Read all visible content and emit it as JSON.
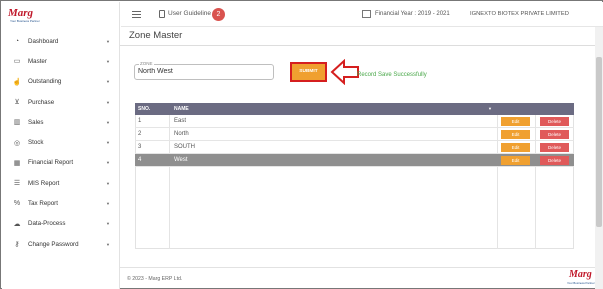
{
  "brand": {
    "logo_text": "Marg",
    "tagline": "Your Business Partner"
  },
  "sidebar": {
    "items": [
      {
        "label": "Dashboard",
        "icon": "dashboard-icon"
      },
      {
        "label": "Master",
        "icon": "folder-icon"
      },
      {
        "label": "Outstanding",
        "icon": "thumbs-up-icon"
      },
      {
        "label": "Purchase",
        "icon": "cart-icon"
      },
      {
        "label": "Sales",
        "icon": "chart-icon"
      },
      {
        "label": "Stock",
        "icon": "database-icon"
      },
      {
        "label": "Financial Report",
        "icon": "building-icon"
      },
      {
        "label": "MIS Report",
        "icon": "list-icon"
      },
      {
        "label": "Tax Report",
        "icon": "percent-icon"
      },
      {
        "label": "Data-Process",
        "icon": "cloud-upload-icon"
      },
      {
        "label": "Change Password",
        "icon": "key-icon"
      }
    ]
  },
  "topbar": {
    "user_guideline": "User Guideline",
    "badge_count": "2",
    "financial_year": "Financial Year : 2019 - 2021",
    "company": "IGNEXTO BIOTEX PRIVATE LIMITED"
  },
  "page": {
    "title": "Zone Master",
    "zone_label": "ZONE",
    "zone_value": "North West",
    "submit_label": "SUBMIT",
    "success_message": "Record Save Successfully"
  },
  "table": {
    "headers": {
      "sno": "SNO.",
      "name": "NAME"
    },
    "edit_label": "Edit",
    "delete_label": "Delete",
    "rows": [
      {
        "sno": "1",
        "name": "East"
      },
      {
        "sno": "2",
        "name": "North"
      },
      {
        "sno": "3",
        "name": "SOUTH"
      },
      {
        "sno": "4",
        "name": "West"
      }
    ],
    "selected_row": 4
  },
  "footer": {
    "copyright": "© 2023 - Marg ERP Ltd."
  },
  "colors": {
    "accent_orange": "#f0a030",
    "delete_red": "#e05a5a",
    "header_slate": "#6b6b82",
    "success_green": "#4aa84a",
    "highlight_red": "#d51f1f"
  }
}
